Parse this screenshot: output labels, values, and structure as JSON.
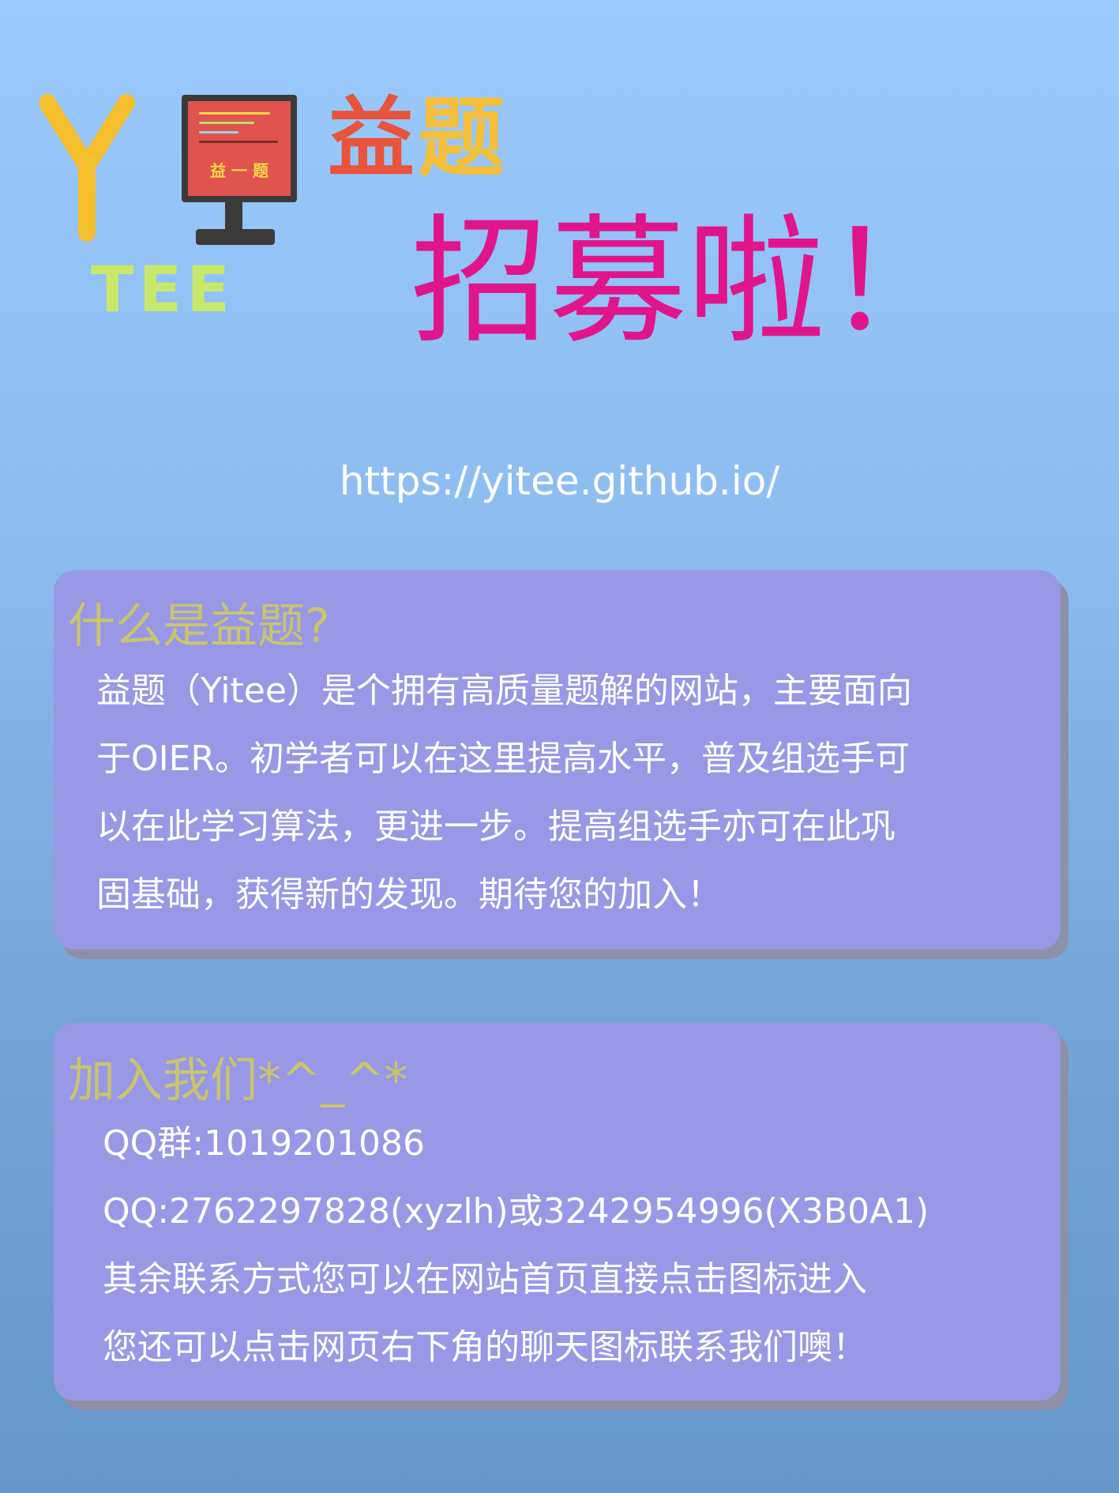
{
  "logo": {
    "monitor_text": "益 一 题",
    "wordmark": "TEE",
    "colors": {
      "y": "#f5bf2e",
      "screen": "#e0534e",
      "frame": "#3a3a3a",
      "wordmark": "#c8e86b"
    }
  },
  "header": {
    "title_char_1": "益",
    "title_char_2": "题",
    "headline": "招募啦！",
    "url": "https://yitee.github.io/"
  },
  "about": {
    "heading": "什么是益题?",
    "lines": [
      "益题（Yitee）是个拥有高质量题解的网站，主要面向",
      "于OIER。初学者可以在这里提高水平，普及组选手可",
      "以在此学习算法，更进一步。提高组选手亦可在此巩",
      "固基础，获得新的发现。期待您的加入！"
    ]
  },
  "join": {
    "heading": "加入我们*^_^*",
    "lines": [
      "QQ群:1019201086",
      "QQ:2762297828(xyzlh)或3242954996(X3B0A1)",
      "其余联系方式您可以在网站首页直接点击图标进入",
      "您还可以点击网页右下角的聊天图标联系我们噢！"
    ]
  },
  "colors": {
    "background_top": "#99c9fd",
    "background_bottom": "#6497ca",
    "panel": "#9898e6",
    "heading": "#c9c46e",
    "headline": "#e0158c"
  }
}
